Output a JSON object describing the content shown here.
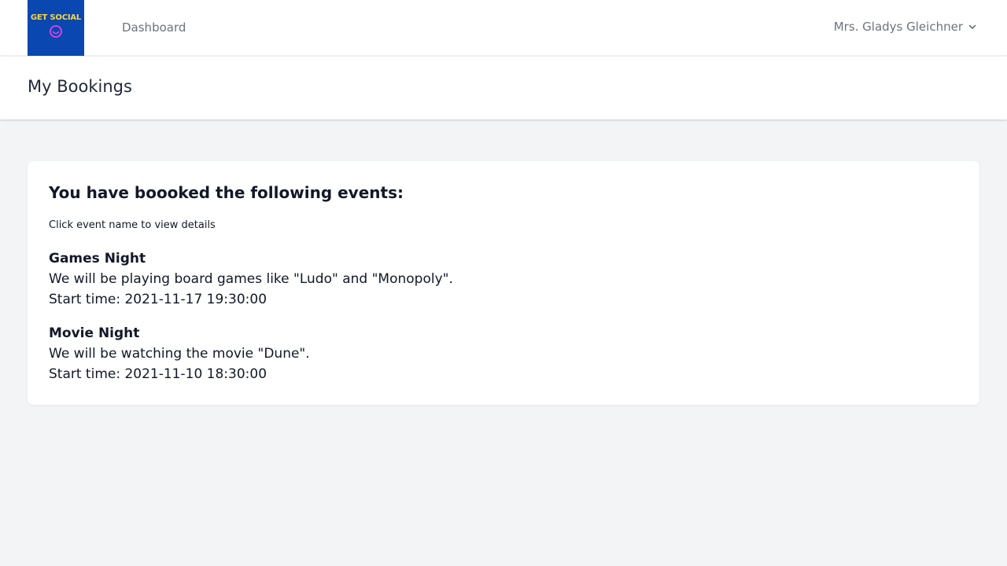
{
  "nav": {
    "logo_text": "GET SOCIAL",
    "logo_icon": "smiley-icon",
    "links": [
      {
        "label": "Dashboard"
      }
    ],
    "user": {
      "name": "Mrs. Gladys Gleichner",
      "icon": "chevron-down-icon"
    }
  },
  "header": {
    "title": "My Bookings"
  },
  "bookings": {
    "heading": "You have boooked the following events:",
    "hint": "Click event name to view details",
    "events": [
      {
        "name": "Games Night",
        "description": "We will be playing board games like \"Ludo\" and \"Monopoly\".",
        "start_time": "Start time: 2021-11-17 19:30:00"
      },
      {
        "name": "Movie Night",
        "description": "We will be watching the movie \"Dune\".",
        "start_time": "Start time: 2021-11-10 18:30:00"
      }
    ]
  },
  "colors": {
    "logo_bg": "#0a47b0",
    "logo_text": "#f5d547",
    "logo_icon": "#d946ef",
    "page_bg": "#f3f4f6",
    "muted_text": "#6b7280"
  }
}
